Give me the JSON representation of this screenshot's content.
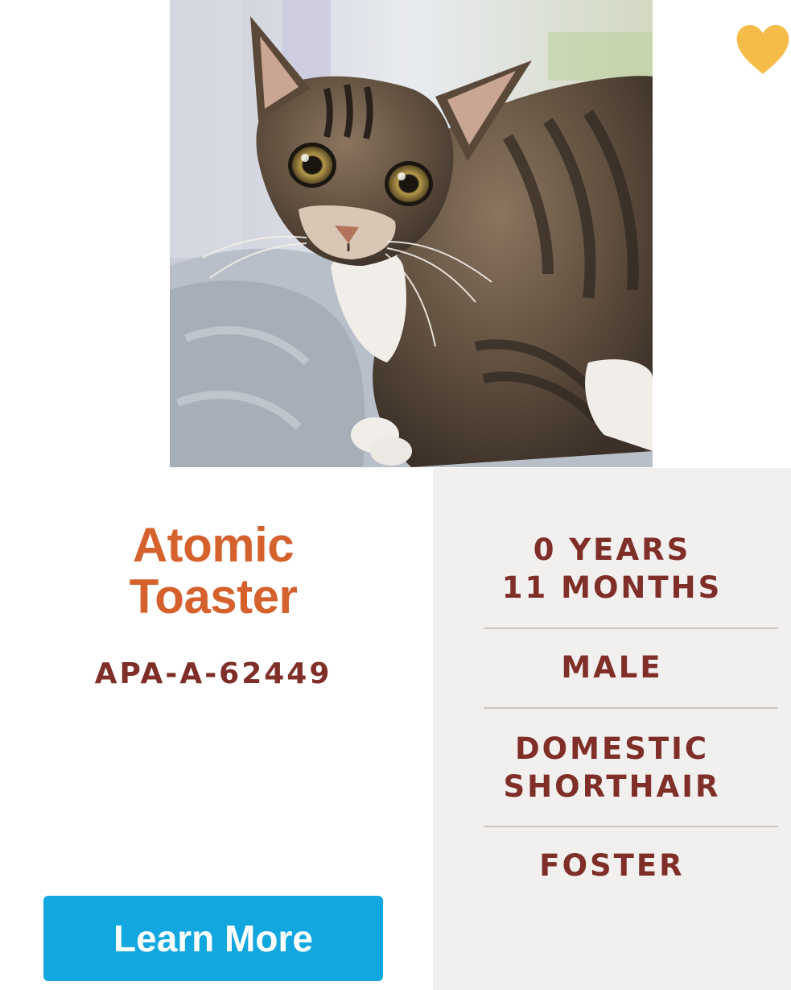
{
  "favorite": {
    "icon": "heart-icon",
    "color": "#f6bc4a"
  },
  "pet": {
    "name_line1": "Atomic",
    "name_line2": "Toaster",
    "id": "APA-A-62449"
  },
  "details": {
    "age_line1": "0 YEARS",
    "age_line2": "11 MONTHS",
    "sex": "MALE",
    "breed_line1": "DOMESTIC",
    "breed_line2": "SHORTHAIR",
    "location": "FOSTER"
  },
  "actions": {
    "learn_more_label": "Learn More"
  },
  "colors": {
    "name": "#d5612c",
    "details_text": "#7f2e28",
    "button": "#12a7df",
    "details_panel": "#f2f0ef"
  }
}
